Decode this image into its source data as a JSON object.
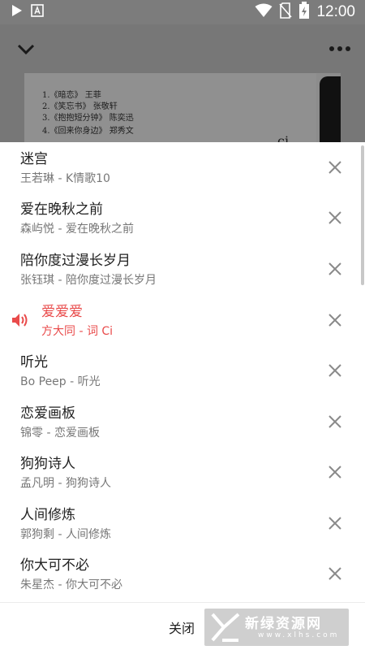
{
  "status_bar": {
    "time": "12:00",
    "icons": [
      "play-notification-icon",
      "app-notification-icon",
      "wifi-icon",
      "no-sim-icon",
      "battery-charging-icon"
    ]
  },
  "player": {
    "cover_text": [
      "1.《暗恋》 王菲",
      "2.《笑忘书》 张敬轩",
      "3.《抱抱短分钟》 陈奕迅",
      "4.《回来你身边》 郑秀文"
    ],
    "cover_ci": "ci"
  },
  "playlist": {
    "songs": [
      {
        "title": "迷宫",
        "subtitle": "王若琳 - K情歌10",
        "playing": false
      },
      {
        "title": "爱在晚秋之前",
        "subtitle": "森屿悦 - 爱在晚秋之前",
        "playing": false
      },
      {
        "title": "陪你度过漫长岁月",
        "subtitle": "张钰琪 - 陪你度过漫长岁月",
        "playing": false
      },
      {
        "title": "爱爱爱",
        "subtitle": "方大同 - 词 Ci",
        "playing": true
      },
      {
        "title": "听光",
        "subtitle": "Bo Peep - 听光",
        "playing": false
      },
      {
        "title": "恋爱画板",
        "subtitle": "锦零 - 恋爱画板",
        "playing": false
      },
      {
        "title": "狗狗诗人",
        "subtitle": "孟凡明 - 狗狗诗人",
        "playing": false
      },
      {
        "title": "人间修炼",
        "subtitle": "郭狗剩 - 人间修炼",
        "playing": false
      },
      {
        "title": "你大可不必",
        "subtitle": "朱星杰 - 你大可不必",
        "playing": false
      }
    ],
    "close_label": "关闭"
  },
  "colors": {
    "playing": "#e94b4b",
    "title": "#222222",
    "subtitle": "#777777"
  },
  "watermark": {
    "text": "新绿资源网",
    "sub": "www.xlhs.com"
  }
}
